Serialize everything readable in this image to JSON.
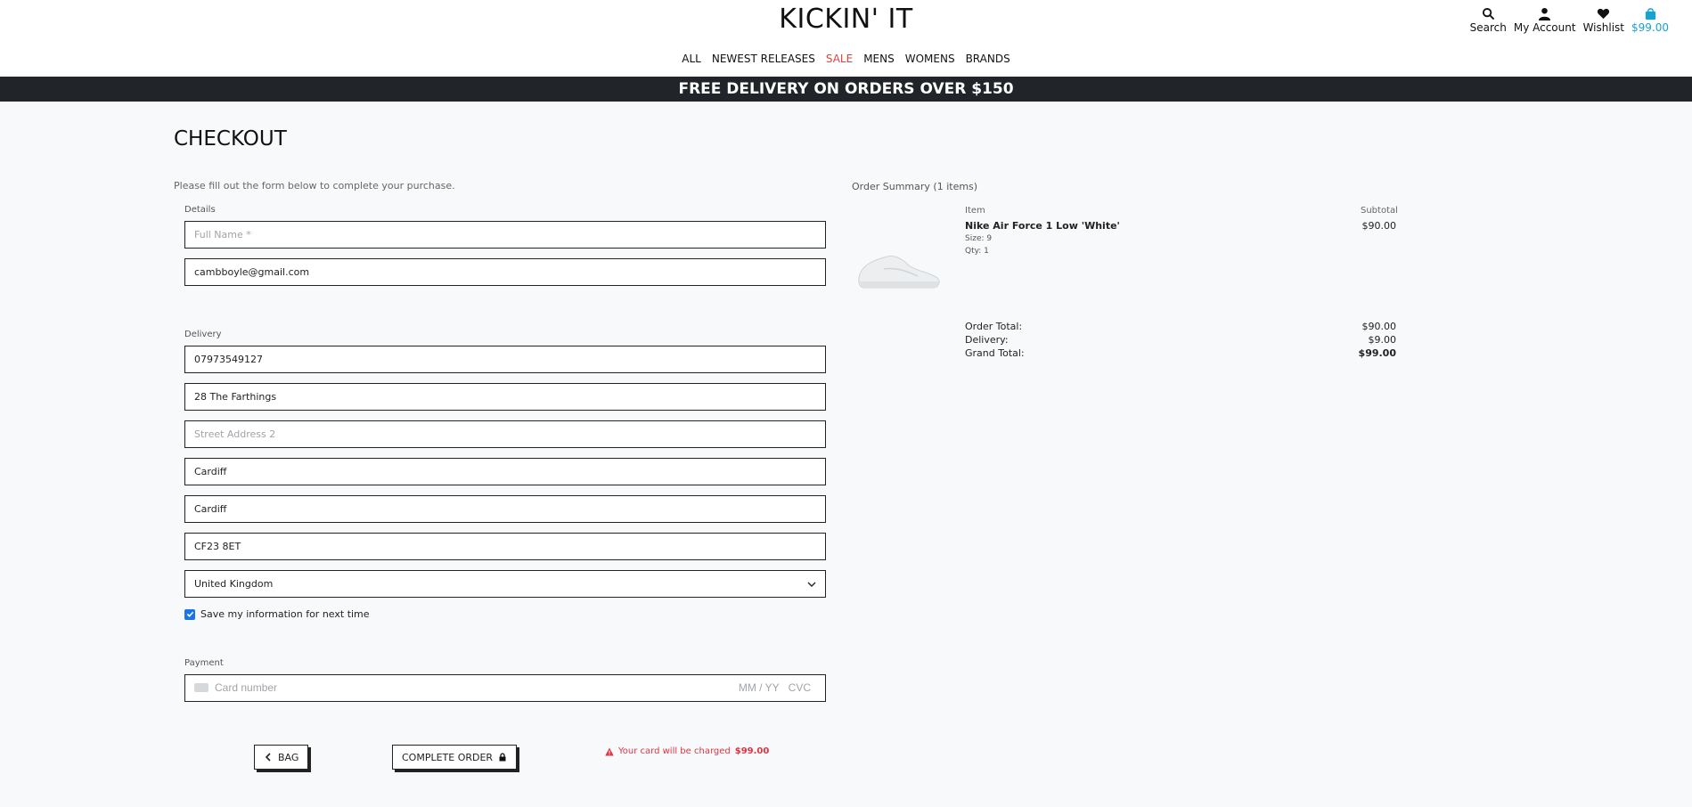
{
  "header": {
    "logo": "KICKIN' IT",
    "icons": {
      "search": "Search",
      "account": "My Account",
      "wishlist": "Wishlist",
      "bag_total": "$99.00"
    },
    "nav": [
      "ALL",
      "NEWEST RELEASES",
      "SALE",
      "MENS",
      "WOMENS",
      "BRANDS"
    ]
  },
  "banner": "FREE DELIVERY ON ORDERS OVER $150",
  "page_title": "CHECKOUT",
  "form": {
    "intro": "Please fill out the form below to complete your purchase.",
    "details_label": "Details",
    "full_name_placeholder": "Full Name *",
    "email_value": "cambboyle@gmail.com",
    "delivery_label": "Delivery",
    "phone_value": "07973549127",
    "street1_value": "28 The Farthings",
    "street2_placeholder": "Street Address 2",
    "town_value": "Cardiff",
    "county_value": "Cardiff",
    "postcode_value": "CF23 8ET",
    "country_value": "United Kingdom",
    "save_info_label": "Save my information for next time",
    "save_info_checked": true,
    "payment_label": "Payment",
    "card_placeholder": "Card number",
    "expiry_placeholder": "MM / YY",
    "cvc_placeholder": "CVC"
  },
  "actions": {
    "bag_button": "BAG",
    "complete_button": "COMPLETE ORDER",
    "charge_text": "Your card will be charged",
    "charge_amount": "$99.00"
  },
  "summary": {
    "title": "Order Summary (1 items)",
    "col_item": "Item",
    "col_subtotal": "Subtotal",
    "product": {
      "name": "Nike Air Force 1 Low 'White'",
      "size": "Size: 9",
      "qty": "Qty: 1",
      "subtotal": "$90.00"
    },
    "order_total_label": "Order Total:",
    "order_total": "$90.00",
    "delivery_label": "Delivery:",
    "delivery": "$9.00",
    "grand_total_label": "Grand Total:",
    "grand_total": "$99.00"
  },
  "colors": {
    "accent_sale": "#e0423a",
    "bag_accent": "#17a2d0",
    "banner_bg": "#212529",
    "warning": "#dc3545"
  }
}
